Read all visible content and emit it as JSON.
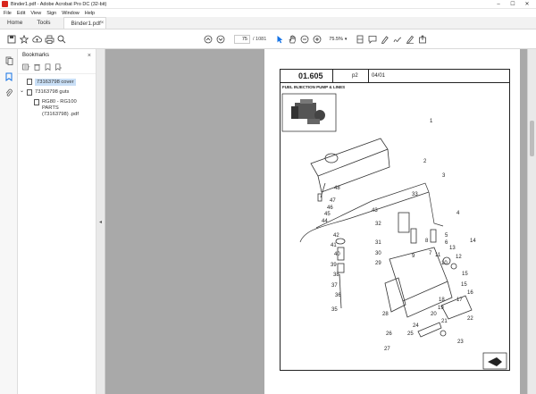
{
  "window": {
    "title": "Binder1.pdf - Adobe Acrobat Pro DC (32-bit)",
    "controls": [
      "–",
      "☐",
      "✕"
    ]
  },
  "menu": [
    "File",
    "Edit",
    "View",
    "Sign",
    "Window",
    "Help"
  ],
  "tabs": {
    "home": "Home",
    "tools": "Tools",
    "document": "Binder1.pdf",
    "close": "×"
  },
  "toolbar": {
    "page_current": "75",
    "page_total": "/ 1081",
    "zoom": "75.5%"
  },
  "bookmarks": {
    "title": "Bookmarks",
    "close": "×",
    "items": [
      {
        "label": "73163798 cover",
        "selected": true,
        "expander": ""
      },
      {
        "label": "73163798 guts",
        "selected": false,
        "expander": "⌄"
      },
      {
        "label": "RG80 - RG100 PARTS (73163798) .pdf",
        "selected": false,
        "expander": ""
      }
    ]
  },
  "page": {
    "code": "01.605",
    "page_ref": "p2",
    "date": "04/01",
    "heading": "FUEL INJECTION PUMP & LINES",
    "callouts": [
      "1",
      "2",
      "3",
      "4",
      "5",
      "6",
      "7",
      "8",
      "9",
      "10",
      "11",
      "12",
      "13",
      "14",
      "15",
      "15",
      "16",
      "17",
      "18",
      "19",
      "20",
      "21",
      "22",
      "23",
      "24",
      "25",
      "26",
      "27",
      "28",
      "29",
      "30",
      "31",
      "32",
      "33",
      "35",
      "36",
      "37",
      "38",
      "39",
      "40",
      "41",
      "42",
      "43",
      "44",
      "45",
      "46",
      "47",
      "48"
    ]
  },
  "colors": {
    "accent": "#1473e6",
    "brand": "#d8251d",
    "selection": "#c9dff6",
    "canvas": "#a9a9a9"
  }
}
